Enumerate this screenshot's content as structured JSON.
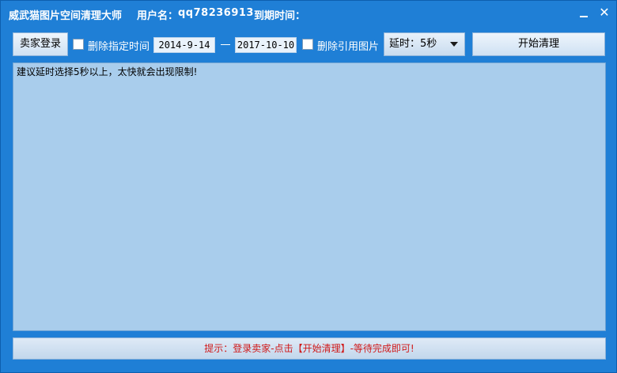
{
  "window": {
    "app_title": "威武猫图片空间清理大师",
    "user_label": "用户名：",
    "user_value": "qq78236913",
    "expire_label": "到期时间：",
    "minimize_icon": "minimize-icon",
    "close_icon": "close-icon",
    "close_glyph": "✕"
  },
  "toolbar": {
    "seller_login_label": "卖家登录",
    "delete_by_date_label": "删除指定时间",
    "delete_by_date_checked": false,
    "date_start": "2014-9-14",
    "date_end": "2017-10-10",
    "delete_referenced_label": "删除引用图片",
    "delete_referenced_checked": false,
    "delay_value": "延时：5秒",
    "start_label": "开始清理"
  },
  "log": {
    "text": "建议延时选择5秒以上，太快就会出现限制!"
  },
  "status": {
    "text": "提示：登录卖家-点击【开始清理】-等待完成即可!"
  },
  "colors": {
    "window_blue": "#1f7fd6",
    "log_background": "#a9cdec",
    "status_text": "#d01818"
  }
}
